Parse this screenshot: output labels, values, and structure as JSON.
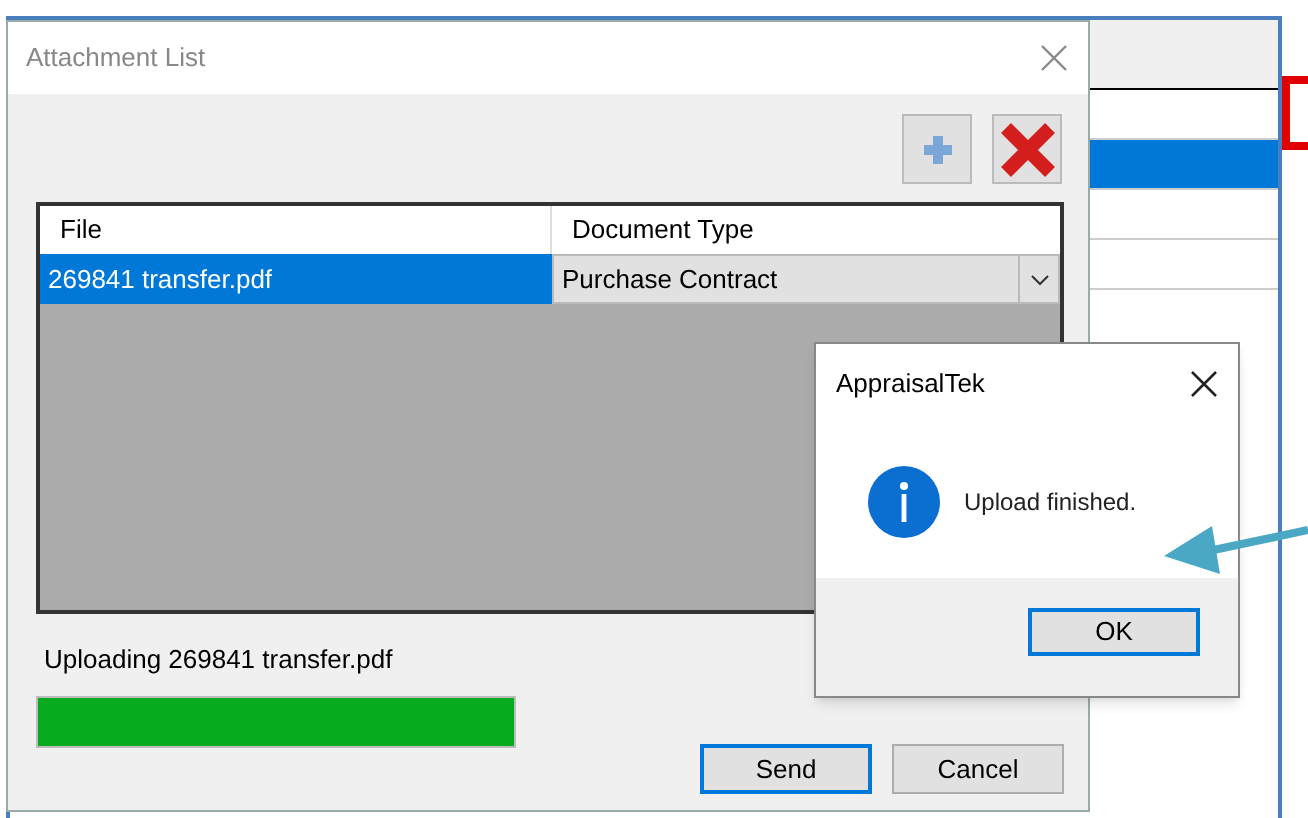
{
  "background_window": {
    "rows": [
      {
        "selected": false
      },
      {
        "selected": true
      },
      {
        "selected": false
      },
      {
        "selected": false
      }
    ]
  },
  "dialog": {
    "title": "Attachment List",
    "table": {
      "columns": [
        "File",
        "Document Type"
      ],
      "rows": [
        {
          "file": "269841 transfer.pdf",
          "document_type": "Purchase Contract",
          "selected": true
        }
      ]
    },
    "status": "Uploading 269841 transfer.pdf",
    "progress": {
      "level": 1
    },
    "buttons": [
      {
        "label": "Send",
        "default": true
      },
      {
        "label": "Cancel",
        "default": false
      }
    ]
  },
  "message_box": {
    "title": "AppraisalTek",
    "message": "Upload finished.",
    "button": {
      "label": "OK",
      "default": true
    }
  }
}
